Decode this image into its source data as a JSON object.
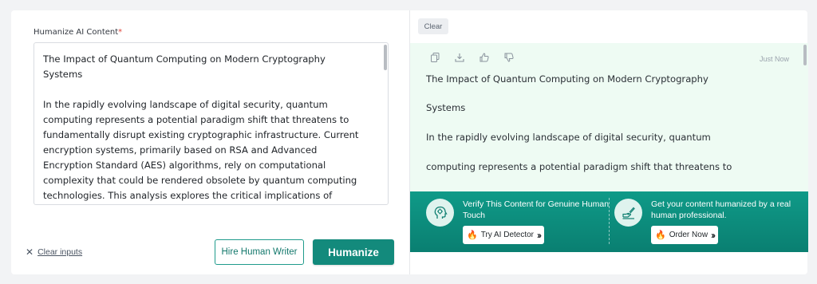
{
  "input": {
    "label": "Humanize AI Content",
    "required_mark": "*",
    "text": "The Impact of Quantum Computing on Modern Cryptography\nSystems\n\nIn the rapidly evolving landscape of digital security, quantum\ncomputing represents a potential paradigm shift that threatens to\nfundamentally disrupt existing cryptographic infrastructure. Current\nencryption systems, primarily based on RSA and Advanced\nEncryption Standard (AES) algorithms, rely on computational\ncomplexity that could be rendered obsolete by quantum computing\ntechnologies. This analysis explores the critical implications of\nquantum algorithms on contemporary cryptographic systems and"
  },
  "actions": {
    "clear_inputs": "Clear inputs",
    "hire_writer": "Hire Human Writer",
    "humanize": "Humanize"
  },
  "output": {
    "clear_button": "Clear",
    "timestamp": "Just Now",
    "toolbar_icons": [
      "copy-icon",
      "download-icon",
      "thumbs-up-icon",
      "thumbs-down-icon"
    ],
    "paragraphs": [
      "The Impact of Quantum Computing on Modern Cryptography",
      "Systems",
      "In the rapidly evolving landscape of digital security, quantum",
      "computing represents a potential paradigm shift that threatens to"
    ]
  },
  "banner": {
    "left": {
      "text": "Verify This Content for Genuine Human Touch",
      "button": "Try AI Detector",
      "icon": "brain-head-icon"
    },
    "right": {
      "text": "Get your content humanized by a real human professional.",
      "button": "Order Now",
      "icon": "writing-hand-icon"
    }
  },
  "colors": {
    "accent": "#138a7c",
    "output_bg": "#eefbf3",
    "banner_bg": "#0c8b7b",
    "required": "#e0453a"
  }
}
